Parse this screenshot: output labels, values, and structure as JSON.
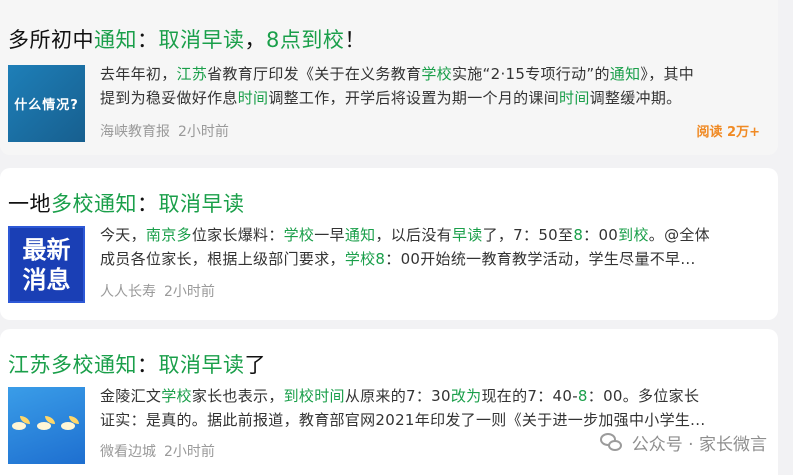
{
  "articles": [
    {
      "title_segments": [
        {
          "text": "多所初中",
          "hl": false
        },
        {
          "text": "通知",
          "hl": true
        },
        {
          "text": "：",
          "hl": false
        },
        {
          "text": "取消早读",
          "hl": true
        },
        {
          "text": "，",
          "hl": false
        },
        {
          "text": "8点到校",
          "hl": true
        },
        {
          "text": "！",
          "hl": false
        }
      ],
      "thumbnail": {
        "text": "什么情况?"
      },
      "excerpt_lines": [
        [
          {
            "text": "去年年初，",
            "hl": false
          },
          {
            "text": "江苏",
            "hl": true
          },
          {
            "text": "省教育厅印发《关于在义务教育",
            "hl": false
          },
          {
            "text": "学校",
            "hl": true
          },
          {
            "text": "实施“2·15专项行动”的",
            "hl": false
          },
          {
            "text": "通知",
            "hl": true
          },
          {
            "text": "》，其中",
            "hl": false
          }
        ],
        [
          {
            "text": "提到为稳妥做好作息",
            "hl": false
          },
          {
            "text": "时间",
            "hl": true
          },
          {
            "text": "调整工作，开学后将设置为期一个月的课间",
            "hl": false
          },
          {
            "text": "时间",
            "hl": true
          },
          {
            "text": "调整缓冲期。",
            "hl": false
          }
        ]
      ],
      "source": "海峡教育报",
      "time": "2小时前",
      "reads": "阅读 2万+"
    },
    {
      "title_segments": [
        {
          "text": "一地",
          "hl": false
        },
        {
          "text": "多校通知",
          "hl": true
        },
        {
          "text": "：",
          "hl": false
        },
        {
          "text": "取消早读",
          "hl": true
        }
      ],
      "thumbnail": {
        "line1": "最新",
        "line2": "消息"
      },
      "excerpt_lines": [
        [
          {
            "text": "今天，",
            "hl": false
          },
          {
            "text": "南京多",
            "hl": true
          },
          {
            "text": "位家长爆料：",
            "hl": false
          },
          {
            "text": "学校",
            "hl": true
          },
          {
            "text": "一早",
            "hl": false
          },
          {
            "text": "通知",
            "hl": true
          },
          {
            "text": "，以后没有",
            "hl": false
          },
          {
            "text": "早读",
            "hl": true
          },
          {
            "text": "了，7：50至",
            "hl": false
          },
          {
            "text": "8",
            "hl": true
          },
          {
            "text": "：00",
            "hl": false
          },
          {
            "text": "到校",
            "hl": true
          },
          {
            "text": "。@全体",
            "hl": false
          }
        ],
        [
          {
            "text": "成员各位家长，根据上级部门要求，",
            "hl": false
          },
          {
            "text": "学校8",
            "hl": true
          },
          {
            "text": "：00开始统一教育教学活动，学生尽量不早...",
            "hl": false
          }
        ]
      ],
      "source": "人人长寿",
      "time": "2小时前"
    },
    {
      "title_segments": [
        {
          "text": "江苏多校通知",
          "hl": true
        },
        {
          "text": "：",
          "hl": false
        },
        {
          "text": "取消早读",
          "hl": true
        },
        {
          "text": "了",
          "hl": false
        }
      ],
      "excerpt_lines": [
        [
          {
            "text": "金陵汇文",
            "hl": false
          },
          {
            "text": "学校",
            "hl": true
          },
          {
            "text": "家长也表示，",
            "hl": false
          },
          {
            "text": "到校时间",
            "hl": true
          },
          {
            "text": "从原来的7：30",
            "hl": false
          },
          {
            "text": "改为",
            "hl": true
          },
          {
            "text": "现在的7：40-",
            "hl": false
          },
          {
            "text": "8",
            "hl": true
          },
          {
            "text": "：00。多位家长",
            "hl": false
          }
        ],
        [
          {
            "text": "证实：是真的。据此前报道，教育部官网2021年印发了一则《关于进一步加强中小学生...",
            "hl": false
          }
        ]
      ],
      "source": "微看边城",
      "time": "2小时前"
    }
  ],
  "watermark": {
    "text": "公众号 · 家长微言"
  },
  "colors": {
    "highlight": "#1a9f4a",
    "reads": "#f08a24",
    "meta": "#9a9a9a"
  }
}
